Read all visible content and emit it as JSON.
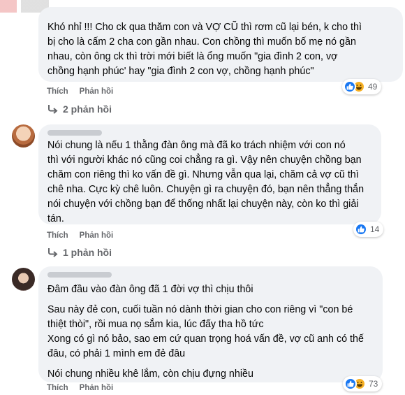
{
  "comments": [
    {
      "text_lines": [
        "Khó nhỉ !!! Cho ck qua thăm con và VỢ CŨ thì rơm cũ lại bén, k cho thì",
        "bị cho là cấm 2 cha con gần nhau. Con chồng thì muốn bố mẹ nó gần",
        "nhau, còn ông ck thì trời mới biết là ổng muốn \"gia đình 2 con, vợ",
        "chồng hạnh phúc' hay \"gia đình 2 con vợ, chồng hạnh phúc\""
      ],
      "like_label": "Thích",
      "reply_label": "Phản hồi",
      "reaction_count": "49",
      "reactions": [
        "like-icon",
        "haha-icon"
      ],
      "replies_link": "2 phản hồi"
    },
    {
      "text_lines": [
        "Nói chung là nếu 1 thằng đàn ông mà đã ko trách nhiệm với con nó",
        "thì với người khác nó cũng coi chẳng ra gì. Vậy nên chuyện chồng bạn",
        "chăm con riêng thì ko vấn đề gì. Nhưng vẫn qua lại, chăm cả vợ cũ thì",
        "chê nha. Cực kỳ chê luôn. Chuyện gì ra chuyện đó, bạn nên thẳng thắn",
        "nói chuyện với chồng bạn để thống nhất lại chuyện này, còn ko thì giải",
        "tán."
      ],
      "like_label": "Thích",
      "reply_label": "Phản hồi",
      "reaction_count": "14",
      "reactions": [
        "like-icon"
      ],
      "replies_link": "1 phản hồi"
    },
    {
      "paragraphs": [
        "Đâm đầu vào đàn ông đã 1 đời vợ thì chịu thôi",
        "Sau này đẻ con, cuối tuần nó dành thời gian cho con riêng vì \"con bé",
        "thiệt thòi\", rồi mua nọ sắm kia, lúc đấy tha hồ tức",
        "Xong có gì nó bảo, sao em cứ quan trọng hoá vấn đề, vợ cũ anh có thế",
        "đâu, có phải 1 mình em đẻ đâu",
        "Nói chung nhiều khê lắm, còn chịu đựng nhiều"
      ],
      "like_label": "Thích",
      "reply_label": "Phản hồi",
      "reaction_count": "73",
      "reactions": [
        "like-icon",
        "haha-icon"
      ]
    }
  ],
  "colors": {
    "bubble": "#f0f2f5",
    "action_text": "#65676b",
    "like_blue": "#1877f2",
    "haha_yellow": "#f7b125"
  }
}
